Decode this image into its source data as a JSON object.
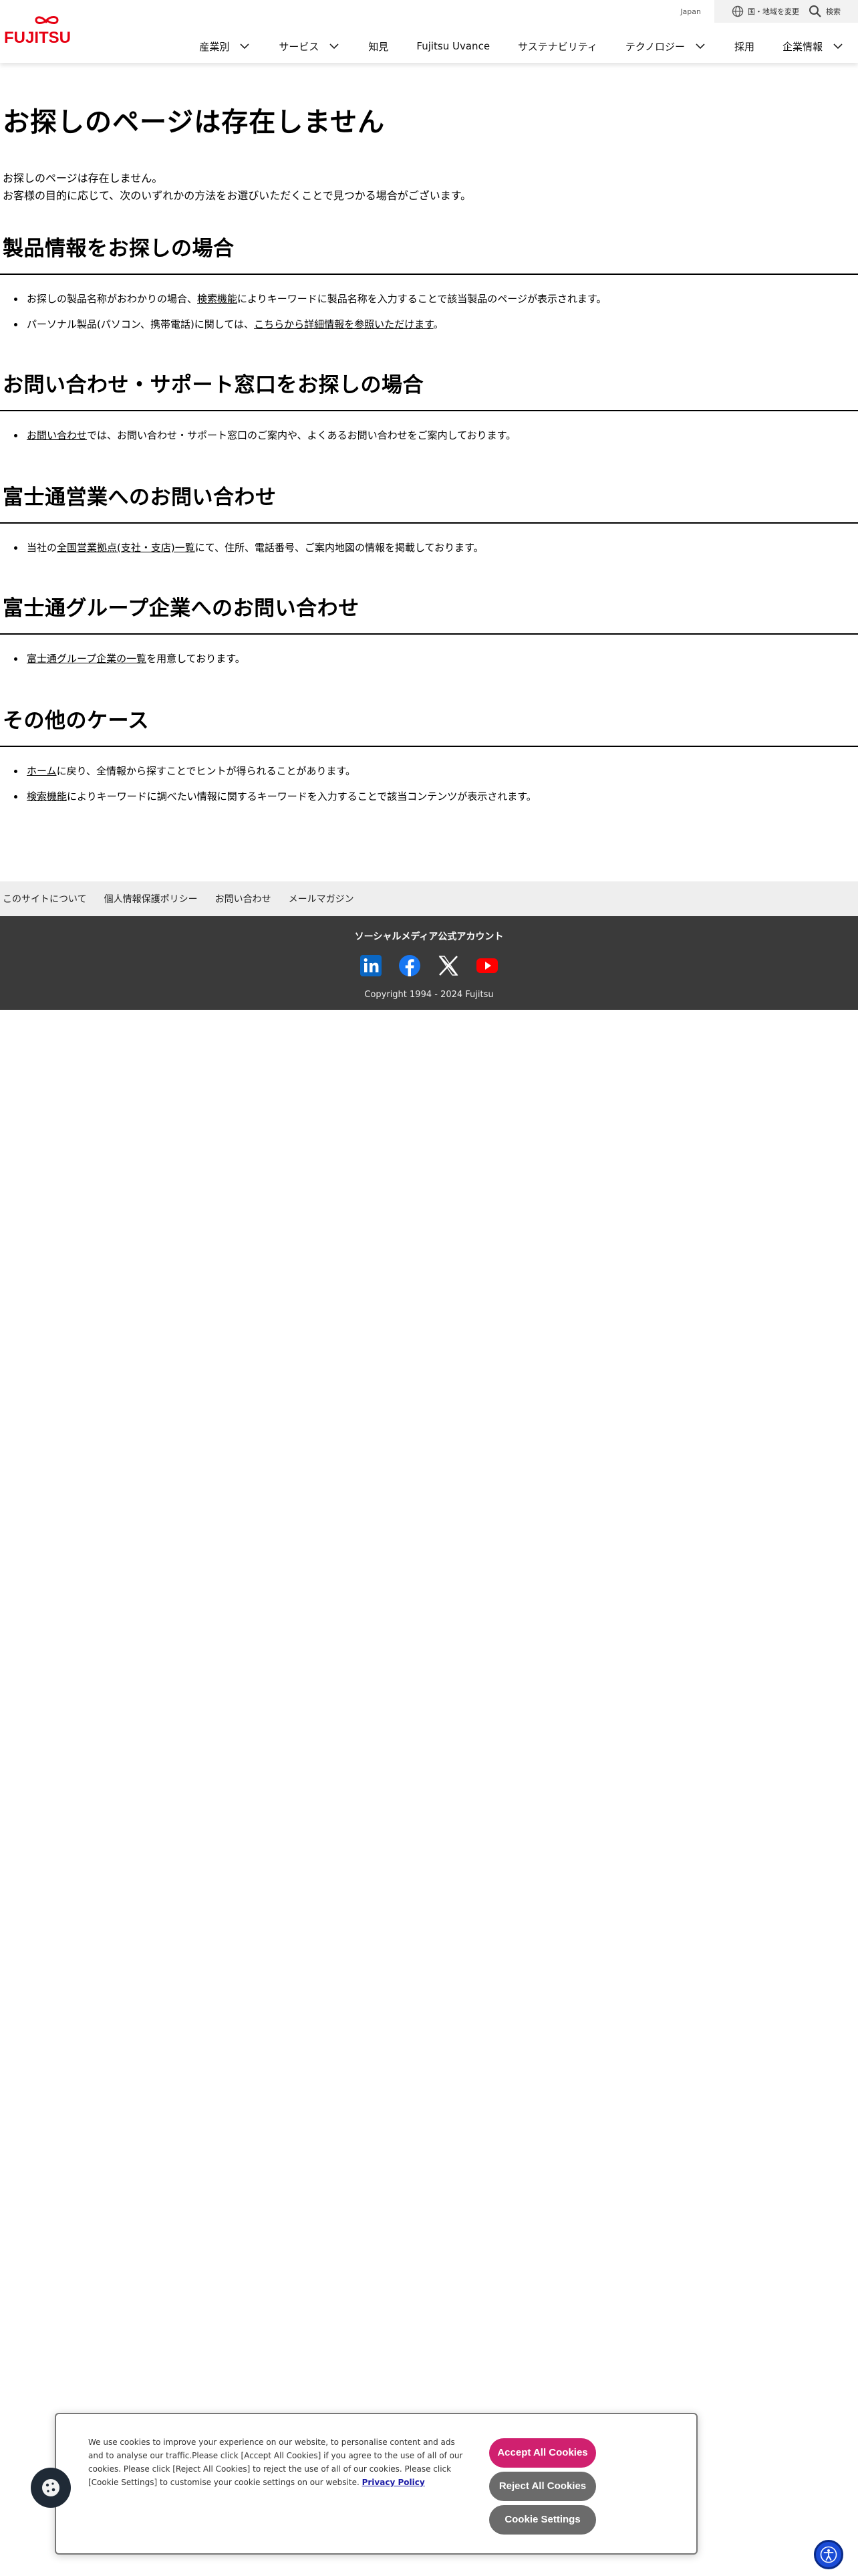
{
  "header": {
    "logo_text": "FUJITSU",
    "region": "Japan",
    "change_region": "国・地域を変更",
    "search": "検索",
    "nav": [
      {
        "label": "産業別",
        "has_dropdown": true
      },
      {
        "label": "サービス",
        "has_dropdown": true
      },
      {
        "label": "知見",
        "has_dropdown": false
      },
      {
        "label": "Fujitsu Uvance",
        "has_dropdown": false
      },
      {
        "label": "サステナビリティ",
        "has_dropdown": false
      },
      {
        "label": "テクノロジー",
        "has_dropdown": true
      },
      {
        "label": "採用",
        "has_dropdown": false
      },
      {
        "label": "企業情報",
        "has_dropdown": true
      }
    ]
  },
  "main": {
    "title": "お探しのページは存在しません",
    "intro_line1": "お探しのページは存在しません。",
    "intro_line2": "お客様の目的に応じて、次のいずれかの方法をお選びいただくことで見つかる場合がございます。",
    "sections": [
      {
        "heading": "製品情報をお探しの場合",
        "items": [
          {
            "pre": "お探しの製品名称がおわかりの場合、",
            "link": "検索機能",
            "post": "によりキーワードに製品名称を入力することで該当製品のページが表示されます。"
          },
          {
            "pre": "パーソナル製品(パソコン、携帯電話)に関しては、",
            "link": "こちらから詳細情報を参照いただけます",
            "post": "。"
          }
        ]
      },
      {
        "heading": "お問い合わせ・サポート窓口をお探しの場合",
        "items": [
          {
            "pre": "",
            "link": "お問い合わせ",
            "post": "では、お問い合わせ・サポート窓口のご案内や、よくあるお問い合わせをご案内しております。"
          }
        ]
      },
      {
        "heading": "富士通営業へのお問い合わせ",
        "items": [
          {
            "pre": "当社の",
            "link": "全国営業拠点(支社・支店)一覧",
            "post": "にて、住所、電話番号、ご案内地図の情報を掲載しております。"
          }
        ]
      },
      {
        "heading": "富士通グループ企業へのお問い合わせ",
        "items": [
          {
            "pre": "",
            "link": "富士通グループ企業の一覧",
            "post": "を用意しております。"
          }
        ]
      },
      {
        "heading": "その他のケース",
        "items": [
          {
            "pre": "",
            "link": "ホーム",
            "post": "に戻り、全情報から探すことでヒントが得られることがあります。"
          },
          {
            "pre": "",
            "link": "検索機能",
            "post": "によりキーワードに調べたい情報に関するキーワードを入力することで該当コンテンツが表示されます。"
          }
        ]
      }
    ]
  },
  "footer": {
    "links": [
      "このサイトについて",
      "個人情報保護ポリシー",
      "お問い合わせ",
      "メールマガジン"
    ],
    "social_title": "ソーシャルメディア公式アカウント",
    "social_icons": [
      "linkedin-icon",
      "facebook-icon",
      "x-icon",
      "youtube-icon"
    ],
    "copyright": "Copyright 1994 - 2024 Fujitsu"
  },
  "cookie": {
    "text": "We use cookies to improve your experience on our website, to personalise content and ads and to analyse our traffic.Please click [Accept All Cookies] if you agree to the use of all of our cookies. Please click [Reject All Cookies] to reject the use of all of our cookies. Please click [Cookie Settings] to customise your cookie settings on our website.",
    "policy_link": "Privacy Policy",
    "accept": "Accept All Cookies",
    "reject": "Reject All Cookies",
    "settings": "Cookie Settings"
  },
  "colors": {
    "brand_red": "#e60012",
    "accept_pink": "#d0206f",
    "footer_dark": "#3a3a3a",
    "a11y_blue": "#1a4bd6"
  }
}
